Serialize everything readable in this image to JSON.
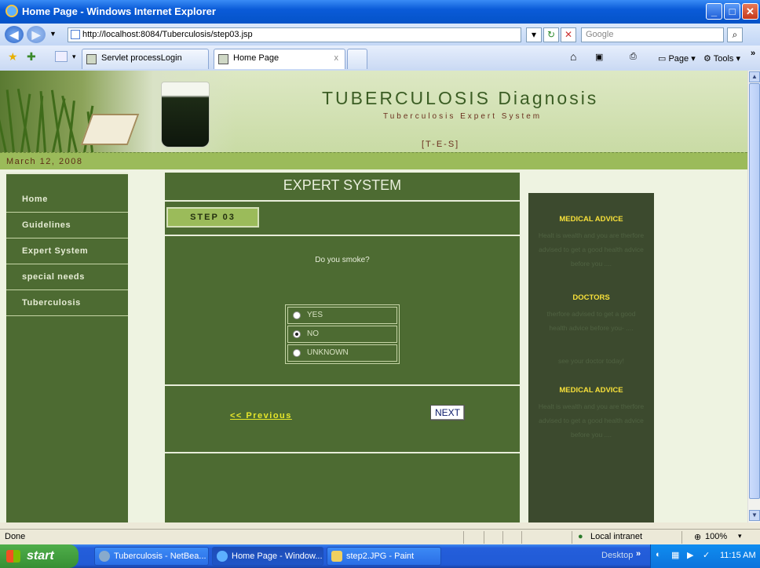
{
  "window": {
    "title": "Home Page - Windows Internet Explorer"
  },
  "address": {
    "url": "http://localhost:8084/Tuberculosis/step03.jsp",
    "search_placeholder": "Google"
  },
  "tabs": [
    {
      "label": "Servlet processLogin"
    },
    {
      "label": "Home Page",
      "close": "x"
    }
  ],
  "toolbar": {
    "page_label": "Page",
    "tools_label": "Tools"
  },
  "header": {
    "title": "TUBERCULOSIS Diagnosis",
    "subtitle": "Tuberculosis Expert System",
    "tag": "[T-E-S]"
  },
  "date": "March 12, 2008",
  "nav": [
    {
      "label": "Home"
    },
    {
      "label": "Guidelines"
    },
    {
      "label": "Expert System"
    },
    {
      "label": "special needs"
    },
    {
      "label": "Tuberculosis"
    }
  ],
  "main": {
    "section_title": "EXPERT SYSTEM",
    "step_label": "STEP 03",
    "question": "Do you smoke?",
    "options": [
      {
        "label": "YES",
        "selected": false
      },
      {
        "label": "NO",
        "selected": true
      },
      {
        "label": "UNKNOWN",
        "selected": false
      }
    ],
    "previous_label": "<< Previous",
    "next_label": "NEXT"
  },
  "sidebar_right": {
    "heading1": "MEDICAL ADVICE",
    "text1a": "Healt is wealth and you are therfore",
    "text1b": "advised to get a good health advice",
    "text1c": "before you ....",
    "heading2": "DOCTORS",
    "text2a": "therfore advised to get a good",
    "text2b": "health advice before you- ....",
    "text2c": "see your doctor today!",
    "heading3": "MEDICAL ADVICE",
    "text3a": "Healt is wealth and you are therfore",
    "text3b": "advised to get a good health advice",
    "text3c": "before you ...."
  },
  "status": {
    "text": "Done",
    "zone": "Local intranet",
    "zoom": "100%"
  },
  "taskbar": {
    "start": "start",
    "buttons": [
      {
        "label": "Tuberculosis - NetBea..."
      },
      {
        "label": "Home Page - Window..."
      },
      {
        "label": "step2.JPG - Paint"
      }
    ],
    "desktop": "Desktop",
    "clock": "11:15 AM"
  }
}
